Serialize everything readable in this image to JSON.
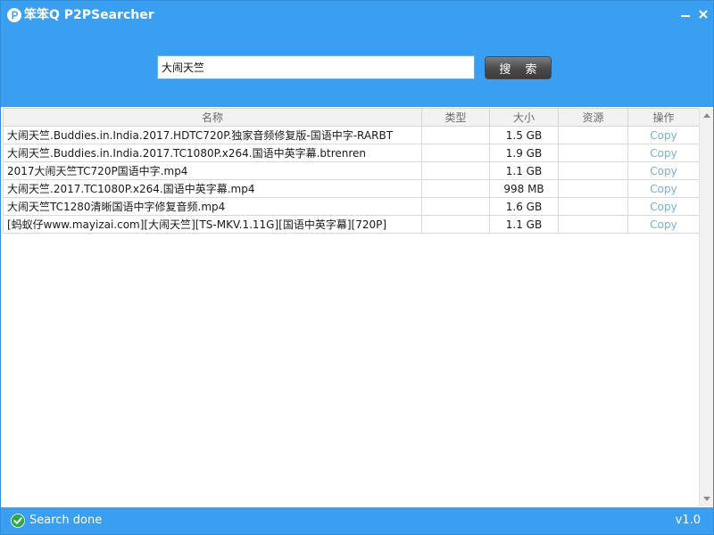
{
  "window": {
    "title": "笨笨Q P2PSearcher",
    "colors": {
      "header": "#3a9ff0",
      "link": "#6fb3e8"
    }
  },
  "search": {
    "value": "大闹天竺",
    "button_label": "搜 索"
  },
  "table": {
    "columns": [
      "名称",
      "类型",
      "大小",
      "资源",
      "操作"
    ],
    "rows": [
      {
        "name": "大闹天竺.Buddies.in.India.2017.HDTC720P.独家音频修复版-国语中字-RARBT",
        "type": "",
        "size": "1.5 GB",
        "source": "",
        "action": "Copy"
      },
      {
        "name": "大闹天竺.Buddies.in.India.2017.TC1080P.x264.国语中英字幕.btrenren",
        "type": "",
        "size": "1.9 GB",
        "source": "",
        "action": "Copy"
      },
      {
        "name": "2017大闹天竺TC720P国语中字.mp4",
        "type": "",
        "size": "1.1 GB",
        "source": "",
        "action": "Copy"
      },
      {
        "name": "大闹天竺.2017.TC1080P.x264.国语中英字幕.mp4",
        "type": "",
        "size": "998 MB",
        "source": "",
        "action": "Copy"
      },
      {
        "name": "大闹天竺TC1280清晰国语中字修复音频.mp4",
        "type": "",
        "size": "1.6 GB",
        "source": "",
        "action": "Copy"
      },
      {
        "name": "[蚂蚁仔www.mayizai.com][大闹天竺][TS-MKV.1.11G][国语中英字幕][720P]",
        "type": "",
        "size": "1.1 GB",
        "source": "",
        "action": "Copy"
      }
    ]
  },
  "status": {
    "text": "Search done",
    "version": "v1.0",
    "icon": "check-circle-icon"
  }
}
